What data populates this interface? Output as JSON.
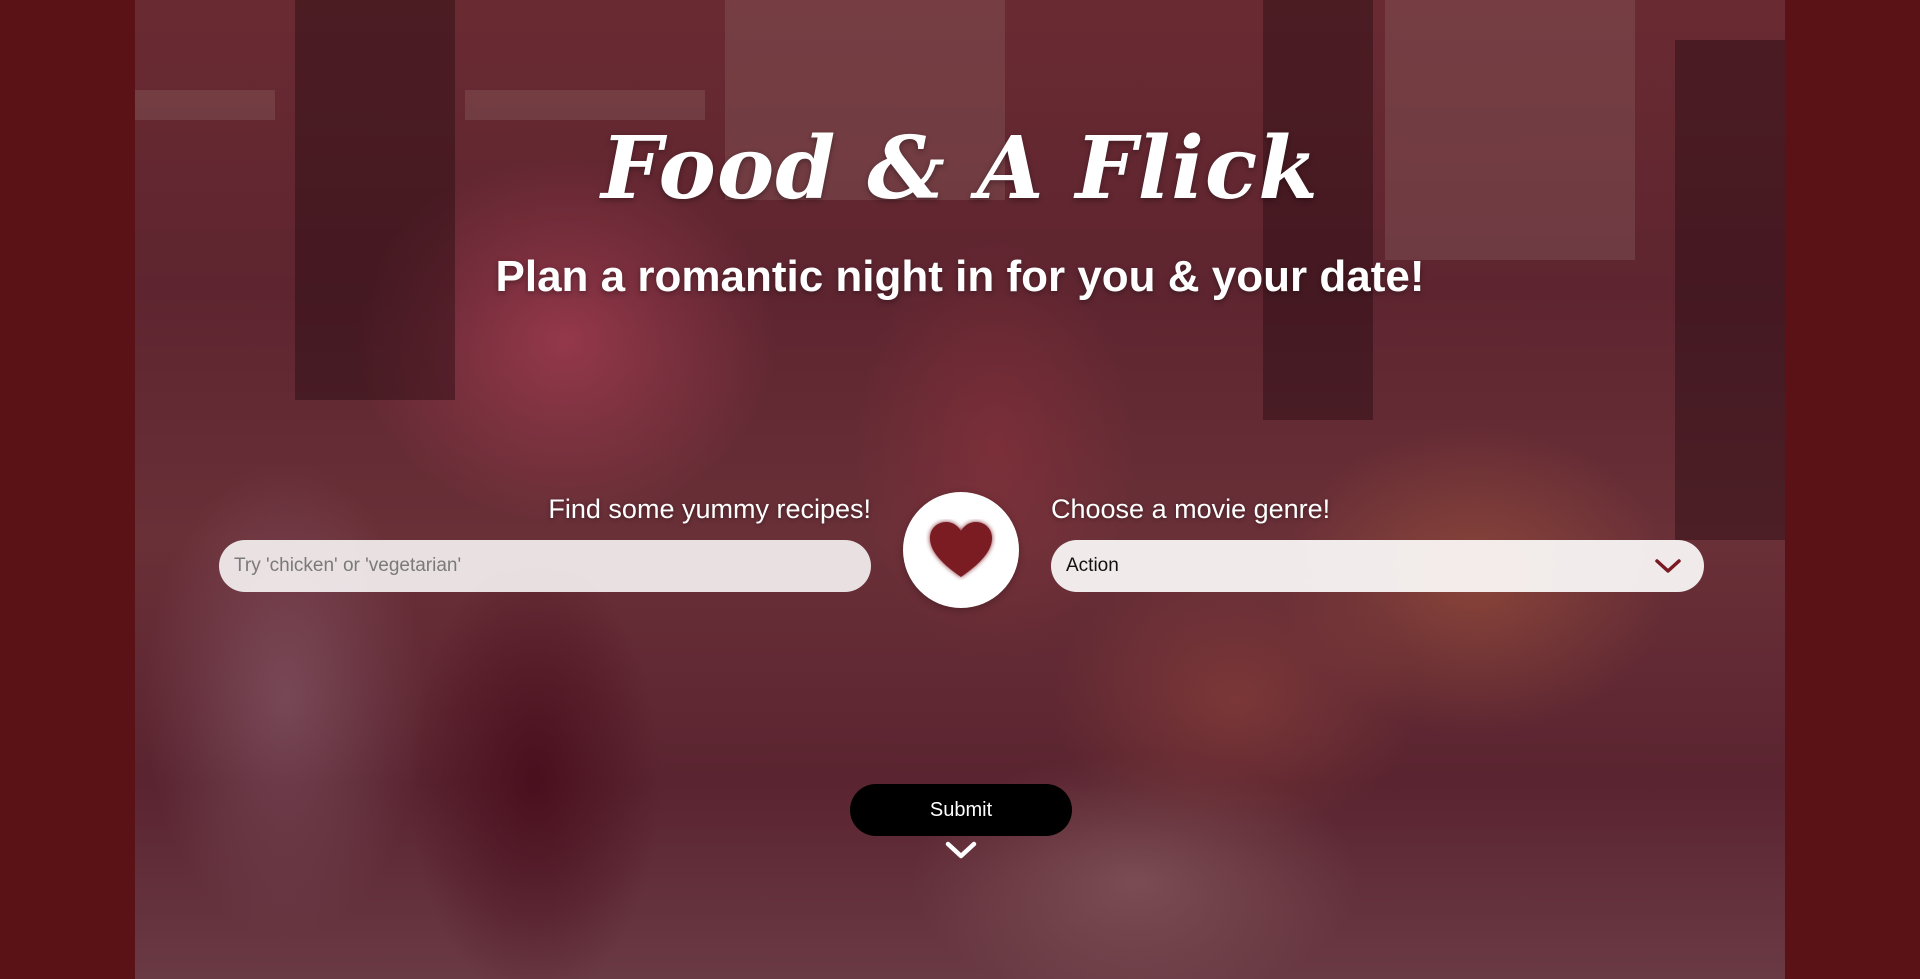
{
  "header": {
    "title": "Food & A Flick",
    "subtitle": "Plan a romantic night in for you & your date!"
  },
  "recipe": {
    "label": "Find some yummy recipes!",
    "placeholder": "Try 'chicken' or 'vegetarian'",
    "value": ""
  },
  "movie": {
    "label": "Choose a movie genre!",
    "selected": "Action"
  },
  "center_icon": "heart-icon",
  "submit": {
    "label": "Submit"
  },
  "scroll_icon": "chevron-down-icon",
  "colors": {
    "frame": "#5a1216",
    "heart": "#7a1a22",
    "chevron": "#7a1a22",
    "button": "#000000"
  }
}
